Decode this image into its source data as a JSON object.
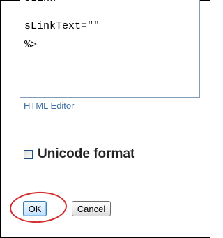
{
  "editor": {
    "lines": [
      "sLink",
      "sLinkText=\"\"",
      "%>"
    ]
  },
  "html_editor_link": "HTML Editor",
  "unicode_option": {
    "label": "Unicode format",
    "checked": false
  },
  "buttons": {
    "ok": "OK",
    "cancel": "Cancel"
  },
  "highlight_color": "#d42d2d"
}
